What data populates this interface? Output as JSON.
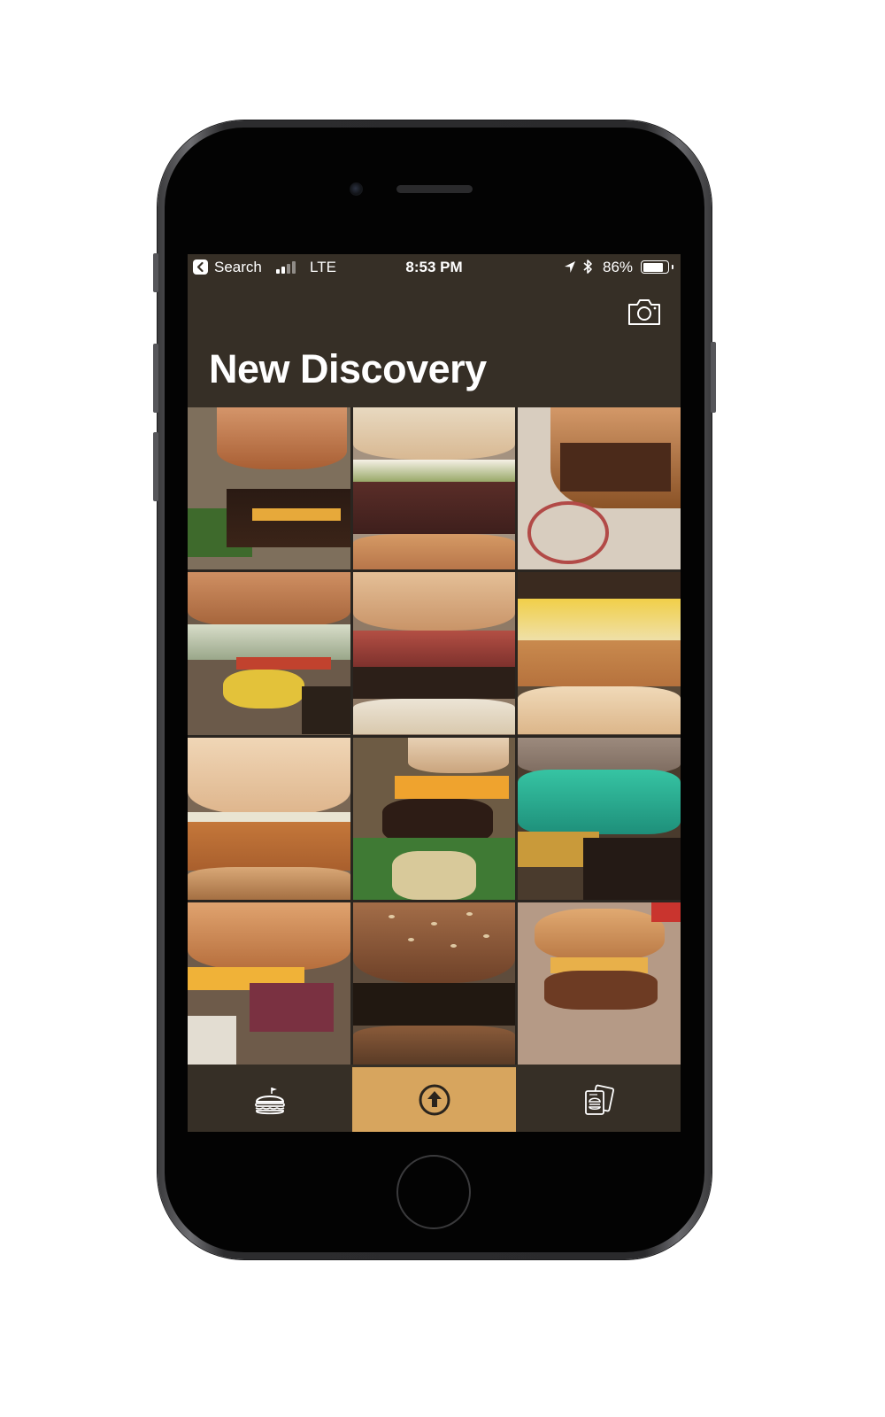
{
  "status_bar": {
    "back_app": "Search",
    "network": "LTE",
    "time": "8:53 PM",
    "battery_percent_text": "86%",
    "battery_level": 0.86,
    "signal_bars_filled": 2,
    "icons": [
      "back-arrow-icon",
      "signal-icon",
      "location-arrow-icon",
      "bluetooth-icon",
      "battery-icon"
    ]
  },
  "header": {
    "camera_icon": "camera-icon",
    "title": "New Discovery"
  },
  "photo_grid": {
    "item_count": 12,
    "subject": "burger-photo"
  },
  "tab_bar": {
    "tabs": [
      {
        "icon": "burger-icon",
        "active": false
      },
      {
        "icon": "upload-arrow-icon",
        "active": true
      },
      {
        "icon": "passport-icon",
        "active": false
      }
    ]
  },
  "colors": {
    "screen_background": "#362f26",
    "accent_active_tab": "#d7a55e",
    "text": "#ffffff",
    "device_bezel": "#030303"
  }
}
